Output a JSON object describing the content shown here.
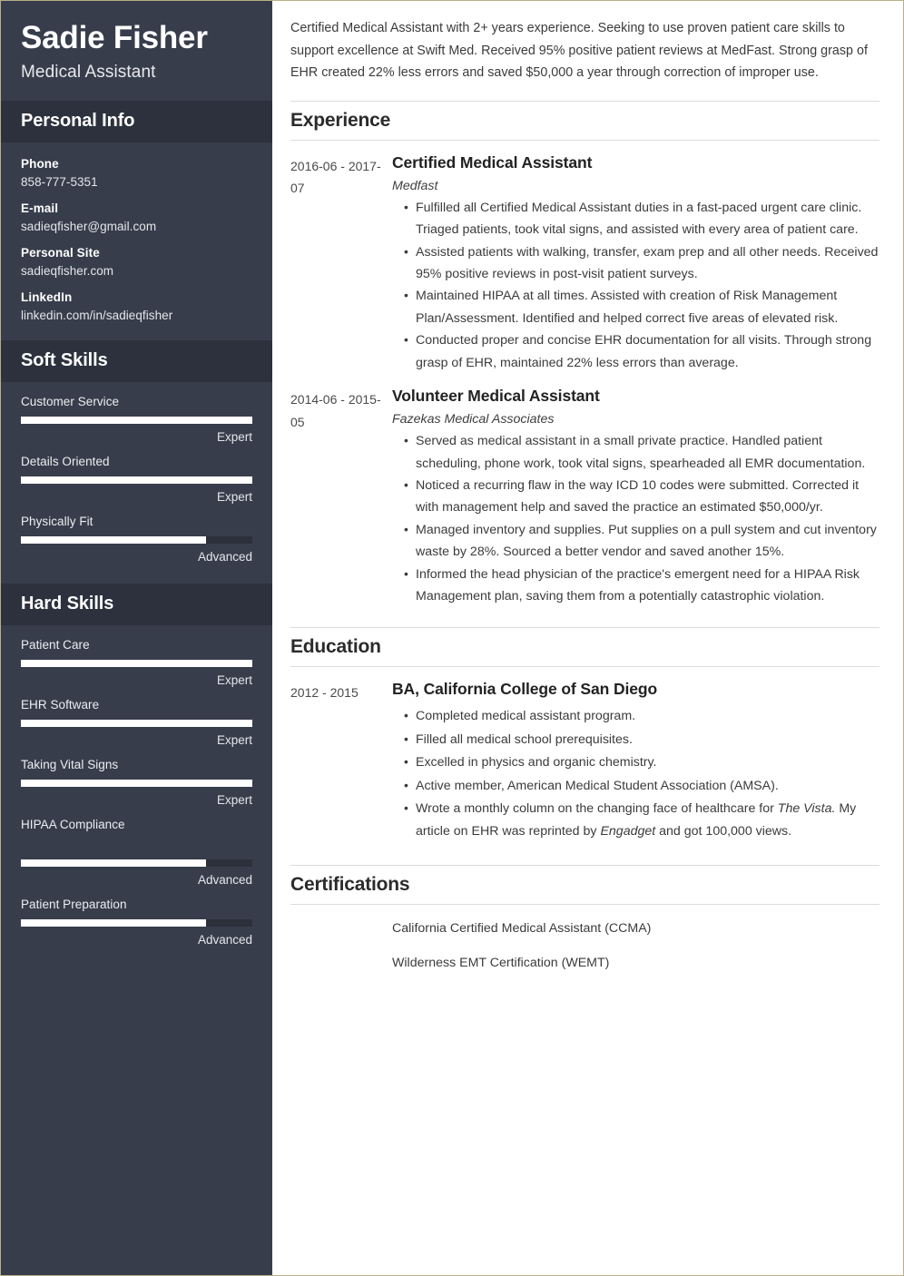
{
  "sidebar": {
    "name": "Sadie Fisher",
    "role": "Medical Assistant",
    "personal_info": {
      "heading": "Personal Info",
      "items": [
        {
          "label": "Phone",
          "value": "858-777-5351"
        },
        {
          "label": "E-mail",
          "value": "sadieqfisher@gmail.com"
        },
        {
          "label": "Personal Site",
          "value": "sadieqfisher.com"
        },
        {
          "label": "LinkedIn",
          "value": "linkedin.com/in/sadieqfisher"
        }
      ]
    },
    "soft_skills": {
      "heading": "Soft Skills",
      "items": [
        {
          "name": "Customer Service",
          "level": "Expert",
          "percent": 100
        },
        {
          "name": "Details Oriented",
          "level": "Expert",
          "percent": 100
        },
        {
          "name": "Physically Fit",
          "level": "Advanced",
          "percent": 80
        }
      ]
    },
    "hard_skills": {
      "heading": "Hard Skills",
      "items": [
        {
          "name": "Patient Care",
          "level": "Expert",
          "percent": 100
        },
        {
          "name": "EHR Software",
          "level": "Expert",
          "percent": 100
        },
        {
          "name": "Taking Vital Signs",
          "level": "Expert",
          "percent": 100
        },
        {
          "name": "HIPAA Compliance",
          "level": "Advanced",
          "percent": 80
        },
        {
          "name": "Patient Preparation",
          "level": "Advanced",
          "percent": 80
        }
      ]
    }
  },
  "main": {
    "summary": "Certified Medical Assistant with 2+ years experience. Seeking to use proven patient care skills to support excellence at Swift Med. Received 95% positive patient reviews at MedFast. Strong grasp of EHR created 22% less errors and saved $50,000 a year through correction of improper use.",
    "experience": {
      "heading": "Experience",
      "entries": [
        {
          "dates": "2016-06 - 2017-07",
          "title": "Certified Medical Assistant",
          "org": "Medfast",
          "bullets": [
            "Fulfilled all Certified Medical Assistant duties in a fast-paced urgent care clinic. Triaged patients, took vital signs, and assisted with every area of patient care.",
            "Assisted patients with walking, transfer, exam prep and all other needs. Received 95% positive reviews in post-visit patient surveys.",
            "Maintained HIPAA at all times. Assisted with creation of Risk Management Plan/Assessment. Identified and helped correct five areas of elevated risk.",
            "Conducted proper and concise EHR documentation for all visits. Through strong grasp of EHR, maintained 22% less errors than average."
          ]
        },
        {
          "dates": "2014-06 - 2015-05",
          "title": "Volunteer Medical Assistant",
          "org": "Fazekas Medical Associates",
          "bullets": [
            "Served as medical assistant in a small private practice. Handled patient scheduling, phone work, took vital signs, spearheaded all EMR documentation.",
            "Noticed a recurring flaw in the way ICD 10 codes were submitted. Corrected it with management help and saved the practice an estimated $50,000/yr.",
            "Managed inventory and supplies. Put supplies on a pull system and cut inventory waste by 28%. Sourced a better vendor and saved another 15%.",
            "Informed the head physician of the practice's emergent need for a HIPAA Risk Management plan, saving them from a potentially catastrophic violation."
          ]
        }
      ]
    },
    "education": {
      "heading": "Education",
      "entries": [
        {
          "dates": "2012 - 2015",
          "title": "BA, California College of San Diego",
          "bullets": [
            "Completed medical assistant program.",
            "Filled all medical school prerequisites.",
            "Excelled in physics and organic chemistry.",
            "Active member, American Medical Student Association (AMSA)."
          ],
          "last_bullet": {
            "part1": "Wrote a monthly column on the changing face of healthcare for ",
            "italic1": "The Vista.",
            "part2": " My article on EHR was reprinted by ",
            "italic2": "Engadget",
            "part3": " and got 100,000 views."
          }
        }
      ]
    },
    "certifications": {
      "heading": "Certifications",
      "items": [
        "California Certified Medical Assistant (CCMA)",
        "Wilderness EMT Certification (WEMT)"
      ]
    }
  },
  "colors": {
    "sidebar_bg": "#373d4b",
    "sidebar_header_bg": "#2c313d",
    "bar_fill": "#ffffff",
    "bar_track": "#2b303b",
    "page_border": "#b9b087"
  }
}
